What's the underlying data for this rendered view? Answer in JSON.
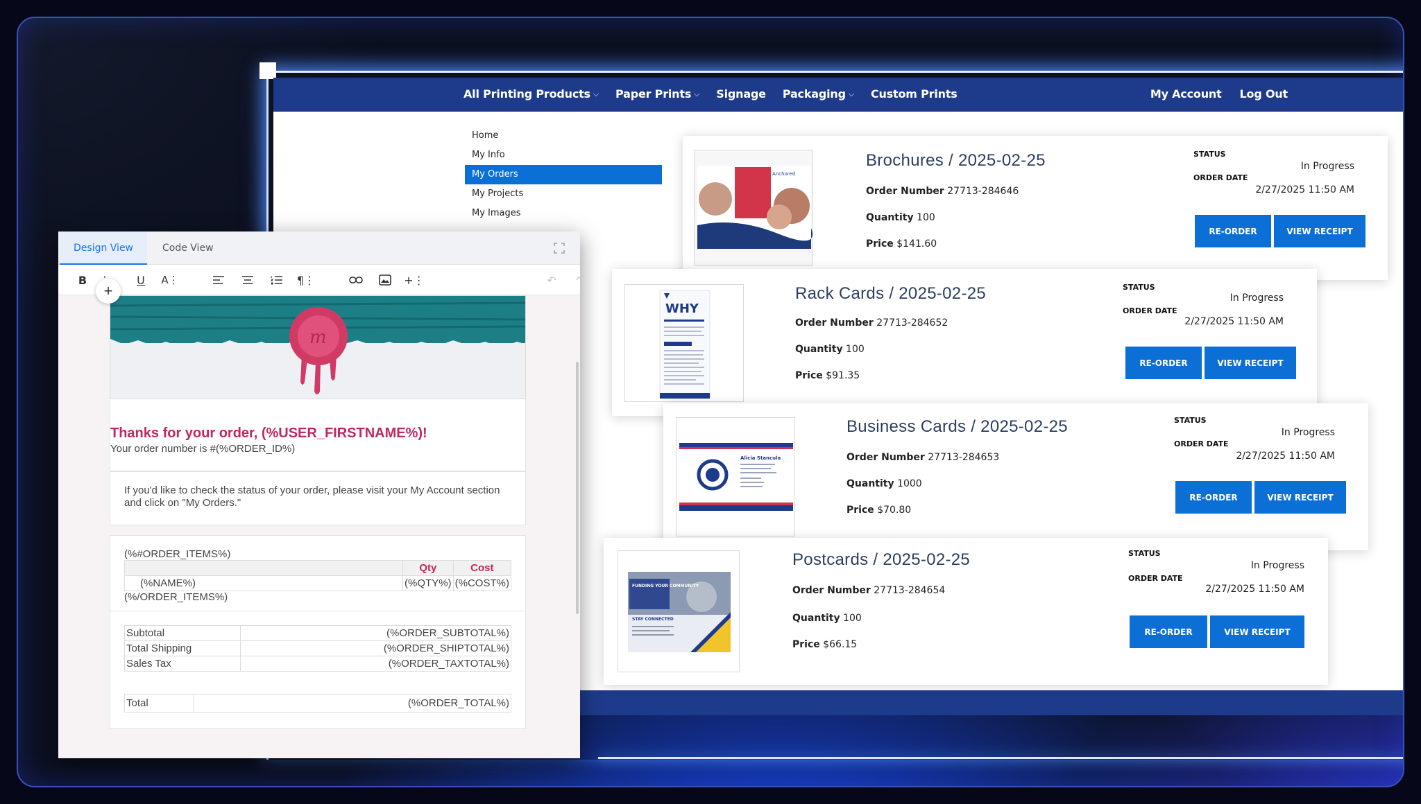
{
  "colors": {
    "nav_bg": "#1e3a8a",
    "accent": "#0b6fd6",
    "email_heading": "#c0285f"
  },
  "nav": {
    "items": [
      {
        "label": "All Printing Products",
        "dropdown": true
      },
      {
        "label": "Paper Prints",
        "dropdown": true
      },
      {
        "label": "Signage",
        "dropdown": false
      },
      {
        "label": "Packaging",
        "dropdown": true
      },
      {
        "label": "Custom Prints",
        "dropdown": false
      }
    ],
    "account": "My Account",
    "logout": "Log Out"
  },
  "side_menu": [
    "Home",
    "My Info",
    "My Orders",
    "My Projects",
    "My Images"
  ],
  "side_menu_active": "My Orders",
  "orders": [
    {
      "title": "Brochures / 2025-02-25",
      "order_number_label": "Order Number",
      "order_number": "27713-284646",
      "quantity_label": "Quantity",
      "quantity": "100",
      "price_label": "Price",
      "price": "$141.60",
      "status_label": "STATUS",
      "status": "In Progress",
      "order_date_label": "ORDER DATE",
      "order_date": "2/27/2025 11:50 AM",
      "reorder": "RE-ORDER",
      "receipt": "VIEW RECEIPT"
    },
    {
      "title": "Rack Cards / 2025-02-25",
      "order_number_label": "Order Number",
      "order_number": "27713-284652",
      "quantity_label": "Quantity",
      "quantity": "100",
      "price_label": "Price",
      "price": "$91.35",
      "status_label": "STATUS",
      "status": "In Progress",
      "order_date_label": "ORDER DATE",
      "order_date": "2/27/2025 11:50 AM",
      "reorder": "RE-ORDER",
      "receipt": "VIEW RECEIPT"
    },
    {
      "title": "Business Cards / 2025-02-25",
      "order_number_label": "Order Number",
      "order_number": "27713-284653",
      "quantity_label": "Quantity",
      "quantity": "1000",
      "price_label": "Price",
      "price": "$70.80",
      "status_label": "STATUS",
      "status": "In Progress",
      "order_date_label": "ORDER DATE",
      "order_date": "2/27/2025 11:50 AM",
      "reorder": "RE-ORDER",
      "receipt": "VIEW RECEIPT"
    },
    {
      "title": "Postcards / 2025-02-25",
      "order_number_label": "Order Number",
      "order_number": "27713-284654",
      "quantity_label": "Quantity",
      "quantity": "100",
      "price_label": "Price",
      "price": "$66.15",
      "status_label": "STATUS",
      "status": "In Progress",
      "order_date_label": "ORDER DATE",
      "order_date": "2/27/2025 11:50 AM",
      "reorder": "RE-ORDER",
      "receipt": "VIEW RECEIPT"
    }
  ],
  "thumbs": {
    "rack_card_heading": "WHY",
    "postcard_heading": "FUNDING YOUR COMMUNITY",
    "postcard_sub": "STAY CONNECTED",
    "business_card_name": "Alicia Stancula"
  },
  "editor": {
    "tabs": [
      "Design View",
      "Code View"
    ],
    "active_tab": "Design View",
    "toolbar_icons": [
      "bold-icon",
      "italic-icon",
      "underline-icon",
      "text-size-icon",
      "align-left-icon",
      "align-center-icon",
      "numbered-list-icon",
      "paragraph-icon",
      "link-icon",
      "image-icon",
      "insert-icon",
      "undo-icon",
      "redo-icon",
      "more-icon"
    ],
    "email": {
      "heading": "Thanks for your order, (%USER_FIRSTNAME%)!",
      "order_line": "Your order number is #(%ORDER_ID%)",
      "status_text": "If you'd like to check the status of your order, please visit your My Account section and click on \"My Orders.\"",
      "items_open": "(%#ORDER_ITEMS%)",
      "items_close": "(%/ORDER_ITEMS%)",
      "col_qty": "Qty",
      "col_cost": "Cost",
      "row_name": "(%NAME%)",
      "row_qty": "(%QTY%)",
      "row_cost": "(%COST%)",
      "totals": [
        {
          "label": "Subtotal",
          "value": "(%ORDER_SUBTOTAL%)"
        },
        {
          "label": "Total Shipping",
          "value": "(%ORDER_SHIPTOTAL%)"
        },
        {
          "label": "Sales Tax",
          "value": "(%ORDER_TAXTOTAL%)"
        }
      ],
      "total_label": "Total",
      "total_value": "(%ORDER_TOTAL%)"
    }
  }
}
